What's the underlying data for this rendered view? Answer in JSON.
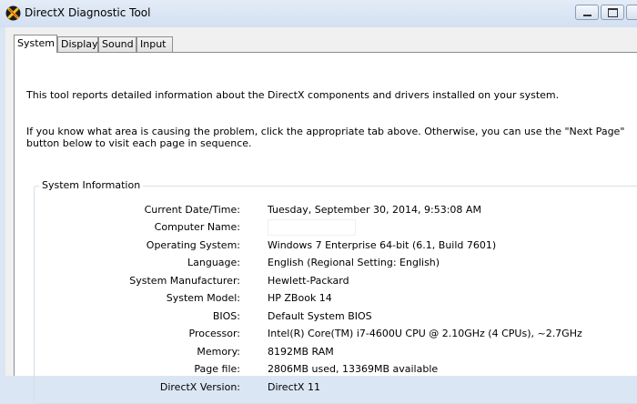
{
  "window": {
    "title": "DirectX Diagnostic Tool",
    "icon": "directx-x-icon"
  },
  "tabs": [
    {
      "label": "System",
      "active": true
    },
    {
      "label": "Display",
      "active": false
    },
    {
      "label": "Sound",
      "active": false
    },
    {
      "label": "Input",
      "active": false
    }
  ],
  "intro": {
    "line1": "This tool reports detailed information about the DirectX components and drivers installed on your system.",
    "line2": "If you know what area is causing the problem, click the appropriate tab above.  Otherwise, you can use the \"Next Page\" button below to visit each page in sequence."
  },
  "system_info": {
    "group_label": "System Information",
    "rows": [
      {
        "label": "Current Date/Time:",
        "value": "Tuesday, September 30, 2014, 9:53:08 AM"
      },
      {
        "label": "Computer Name:",
        "value": ""
      },
      {
        "label": "Operating System:",
        "value": "Windows 7 Enterprise 64-bit (6.1, Build 7601)"
      },
      {
        "label": "Language:",
        "value": "English (Regional Setting: English)"
      },
      {
        "label": "System Manufacturer:",
        "value": "Hewlett-Packard"
      },
      {
        "label": "System Model:",
        "value": "HP ZBook 14"
      },
      {
        "label": "BIOS:",
        "value": "Default System BIOS"
      },
      {
        "label": "Processor:",
        "value": "Intel(R) Core(TM) i7-4600U CPU @ 2.10GHz (4 CPUs), ~2.7GHz"
      },
      {
        "label": "Memory:",
        "value": "8192MB RAM"
      },
      {
        "label": "Page file:",
        "value": "2806MB used, 13369MB available"
      },
      {
        "label": "DirectX Version:",
        "value": "DirectX 11"
      }
    ]
  }
}
